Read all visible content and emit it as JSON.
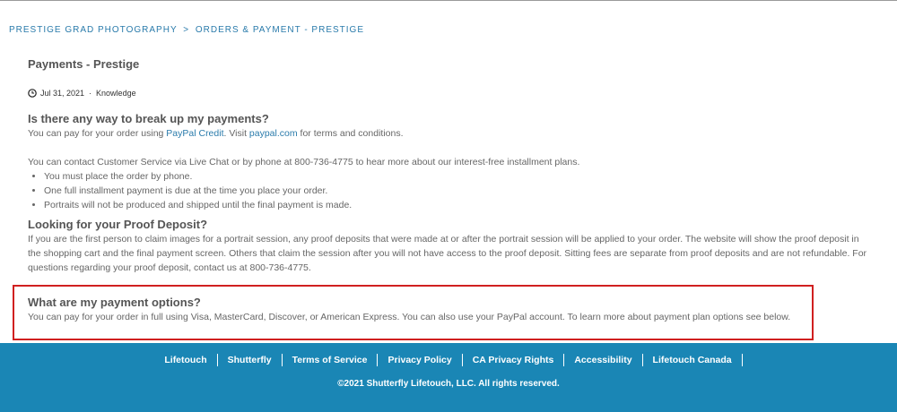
{
  "breadcrumb": {
    "item1": "PRESTIGE GRAD PHOTOGRAPHY",
    "separator": ">",
    "item2": "ORDERS & PAYMENT - PRESTIGE"
  },
  "article": {
    "title": "Payments - Prestige",
    "date": "Jul 31, 2021",
    "separator": "·",
    "category": "Knowledge",
    "section1": {
      "heading": "Is there any way to break up my payments?",
      "line1_prefix": "You can pay for your order using ",
      "line1_link1": "PayPal Credit",
      "line1_mid": ". Visit ",
      "line1_link2": "paypal.com",
      "line1_suffix": " for terms and conditions.",
      "line2": "You can contact Customer Service via Live Chat or by phone at 800-736-4775 to hear more about our interest-free installment plans.",
      "bullets": [
        "You must place the order by phone.",
        "One full installment payment is due at the time you place your order.",
        "Portraits will not be produced and shipped until the final payment is made."
      ]
    },
    "section2": {
      "heading": "Looking for your Proof Deposit?",
      "body": "If you are the first person to claim images for a portrait session, any proof deposits that were made at or after the portrait session will be applied to your order. The website will show the proof deposit in the shopping cart and the final payment screen. Others that claim the session after you will not have access to the proof deposit. Sitting fees are separate from proof deposits and are not refundable. For questions regarding your proof deposit, contact us at 800-736-4775."
    },
    "section3": {
      "heading": "What are my payment options?",
      "body": "You can pay for your order in full using Visa, MasterCard, Discover, or American Express. You can also use your PayPal account. To learn more about payment plan options see below."
    }
  },
  "footer": {
    "links": [
      "Lifetouch",
      "Shutterfly",
      "Terms of Service",
      "Privacy Policy",
      "CA Privacy Rights",
      "Accessibility",
      "Lifetouch Canada"
    ],
    "copyright": "©2021 Shutterfly Lifetouch, LLC. All rights reserved.",
    "background_color": "#1a86b5"
  },
  "colors": {
    "link": "#2a7bab",
    "highlight_border": "#d02020"
  },
  "icons": {
    "date": "clock-icon"
  }
}
